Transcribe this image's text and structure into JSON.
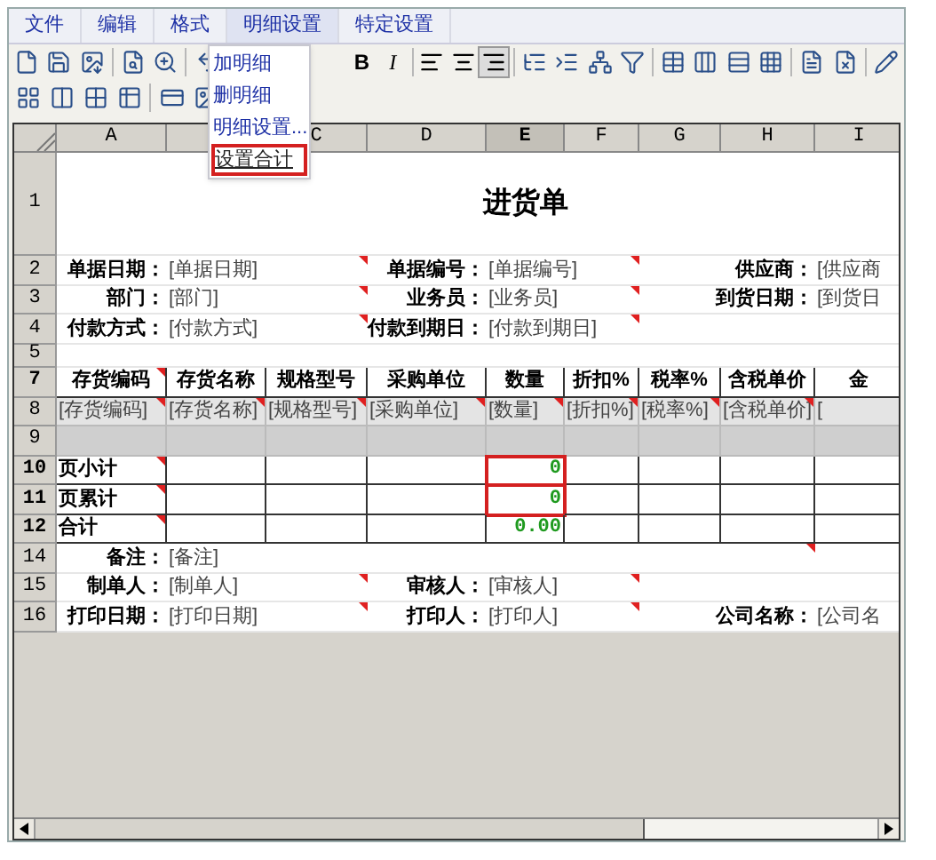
{
  "menu": [
    {
      "label": "文件",
      "open": false
    },
    {
      "label": "编辑",
      "open": false
    },
    {
      "label": "格式",
      "open": false
    },
    {
      "label": "明细设置",
      "open": true
    },
    {
      "label": "特定设置",
      "open": false
    }
  ],
  "dropdown": [
    {
      "label": "加明细",
      "highlighted": false
    },
    {
      "label": "删明细",
      "highlighted": false
    },
    {
      "label": "明细设置...",
      "highlighted": false
    },
    {
      "label": "设置合计",
      "highlighted": true
    }
  ],
  "format_buttons": [
    "B",
    "I"
  ],
  "alignment": [
    {
      "selected": false
    },
    {
      "selected": false
    },
    {
      "selected": true
    }
  ],
  "columns": [
    {
      "label": "A",
      "selected": false
    },
    {
      "selected": false
    },
    {
      "label": "C",
      "selected": false
    },
    {
      "label": "D",
      "selected": false
    },
    {
      "label": "E",
      "selected": true
    },
    {
      "label": "F",
      "selected": false
    },
    {
      "label": "G",
      "selected": false
    },
    {
      "label": "H",
      "selected": false
    },
    {
      "label": "I",
      "selected": false
    }
  ],
  "rows": [
    {
      "number": "1",
      "kind": "title",
      "cells": [
        {},
        {},
        {},
        {},
        {
          "text": "进货单",
          "kind": "title"
        },
        {},
        {},
        {},
        {}
      ]
    },
    {
      "number": "2",
      "kind": "form",
      "cells": [
        {
          "text": "单据日期：",
          "kind": "caption"
        },
        {
          "text": "[单据日期]",
          "kind": "field"
        },
        {
          "marker": true
        },
        {
          "text": "单据编号：",
          "kind": "caption"
        },
        {
          "text": "[单据编号]",
          "kind": "field"
        },
        {
          "marker": true
        },
        {},
        {
          "text": "供应商：",
          "kind": "caption"
        },
        {
          "text": "[供应商",
          "kind": "field"
        }
      ]
    },
    {
      "number": "3",
      "kind": "form",
      "cells": [
        {
          "text": "部门：",
          "kind": "caption"
        },
        {
          "text": "[部门]",
          "kind": "field"
        },
        {
          "marker": true
        },
        {
          "text": "业务员：",
          "kind": "caption"
        },
        {
          "text": "[业务员]",
          "kind": "field"
        },
        {
          "marker": true
        },
        {},
        {
          "text": "到货日期：",
          "kind": "caption"
        },
        {
          "text": "[到货日",
          "kind": "field"
        }
      ]
    },
    {
      "number": "4",
      "kind": "form",
      "cells": [
        {
          "text": "付款方式：",
          "kind": "caption"
        },
        {
          "text": "[付款方式]",
          "kind": "field"
        },
        {
          "marker": true
        },
        {
          "text": "付款到期日：",
          "kind": "caption"
        },
        {
          "text": "[付款到期日]",
          "kind": "field"
        },
        {
          "marker": true
        },
        {},
        {},
        {}
      ]
    },
    {
      "number": "5",
      "kind": "spacer",
      "cells": [
        {},
        {},
        {},
        {},
        {},
        {},
        {},
        {},
        {}
      ]
    },
    {
      "number": "7",
      "kind": "header",
      "cells": [
        {
          "text": "存货编码",
          "kind": "heading",
          "marker": true
        },
        {
          "text": "存货名称",
          "kind": "heading"
        },
        {
          "text": "规格型号",
          "kind": "heading"
        },
        {
          "text": "采购单位",
          "kind": "heading"
        },
        {
          "text": "数量",
          "kind": "heading"
        },
        {
          "text": "折扣%",
          "kind": "heading"
        },
        {
          "text": "税率%",
          "kind": "heading"
        },
        {
          "text": "含税单价",
          "kind": "heading"
        },
        {
          "text": "金",
          "kind": "heading"
        }
      ]
    },
    {
      "number": "8",
      "kind": "detail",
      "cells": [
        {
          "text": "[存货编码]",
          "kind": "field",
          "marker": true
        },
        {
          "text": "[存货名称]",
          "kind": "field",
          "marker": true
        },
        {
          "text": "[规格型号]",
          "kind": "field",
          "marker": true
        },
        {
          "text": "[采购单位]",
          "kind": "field",
          "marker": true
        },
        {
          "text": "[数量]",
          "kind": "field",
          "marker": true
        },
        {
          "text": "[折扣%]",
          "kind": "field",
          "marker": true
        },
        {
          "text": "[税率%]",
          "kind": "field",
          "marker": true
        },
        {
          "text": "[含税单价]",
          "kind": "field",
          "marker": true
        },
        {
          "text": "[",
          "kind": "field"
        }
      ]
    },
    {
      "number": "9",
      "kind": "band",
      "cells": [
        {},
        {},
        {},
        {},
        {},
        {},
        {},
        {},
        {}
      ]
    },
    {
      "number": "10",
      "kind": "summary",
      "cells": [
        {
          "text": "页小计",
          "kind": "summary",
          "marker": true
        },
        {},
        {},
        {},
        {
          "text": "0",
          "kind": "number",
          "highlighted": true
        },
        {},
        {},
        {},
        {}
      ]
    },
    {
      "number": "11",
      "kind": "summary",
      "cells": [
        {
          "text": "页累计",
          "kind": "summary",
          "marker": true
        },
        {},
        {},
        {},
        {
          "text": "0",
          "kind": "number",
          "highlighted": true
        },
        {},
        {},
        {},
        {}
      ]
    },
    {
      "number": "12",
      "kind": "summary",
      "cells": [
        {
          "text": "合计",
          "kind": "summary",
          "marker": true
        },
        {},
        {},
        {},
        {
          "text": "0.00",
          "kind": "number"
        },
        {},
        {},
        {},
        {}
      ]
    },
    {
      "number": "14",
      "kind": "form",
      "cells": [
        {
          "text": "备注：",
          "kind": "caption"
        },
        {
          "text": "[备注]",
          "kind": "field"
        },
        {},
        {},
        {},
        {},
        {},
        {
          "marker": true
        },
        {}
      ]
    },
    {
      "number": "15",
      "kind": "form",
      "cells": [
        {
          "text": "制单人：",
          "kind": "caption"
        },
        {
          "text": "[制单人]",
          "kind": "field"
        },
        {
          "marker": true
        },
        {
          "text": "审核人：",
          "kind": "caption"
        },
        {
          "text": "[审核人]",
          "kind": "field"
        },
        {
          "marker": true
        },
        {},
        {},
        {}
      ]
    },
    {
      "number": "16",
      "kind": "form",
      "cells": [
        {
          "text": "打印日期：",
          "kind": "caption"
        },
        {
          "text": "[打印日期]",
          "kind": "field"
        },
        {
          "marker": true
        },
        {
          "text": "打印人：",
          "kind": "caption"
        },
        {
          "text": "[打印人]",
          "kind": "field"
        },
        {
          "marker": true
        },
        {},
        {
          "text": "公司名称：",
          "kind": "caption"
        },
        {
          "text": "[公司名",
          "kind": "field"
        }
      ]
    }
  ]
}
